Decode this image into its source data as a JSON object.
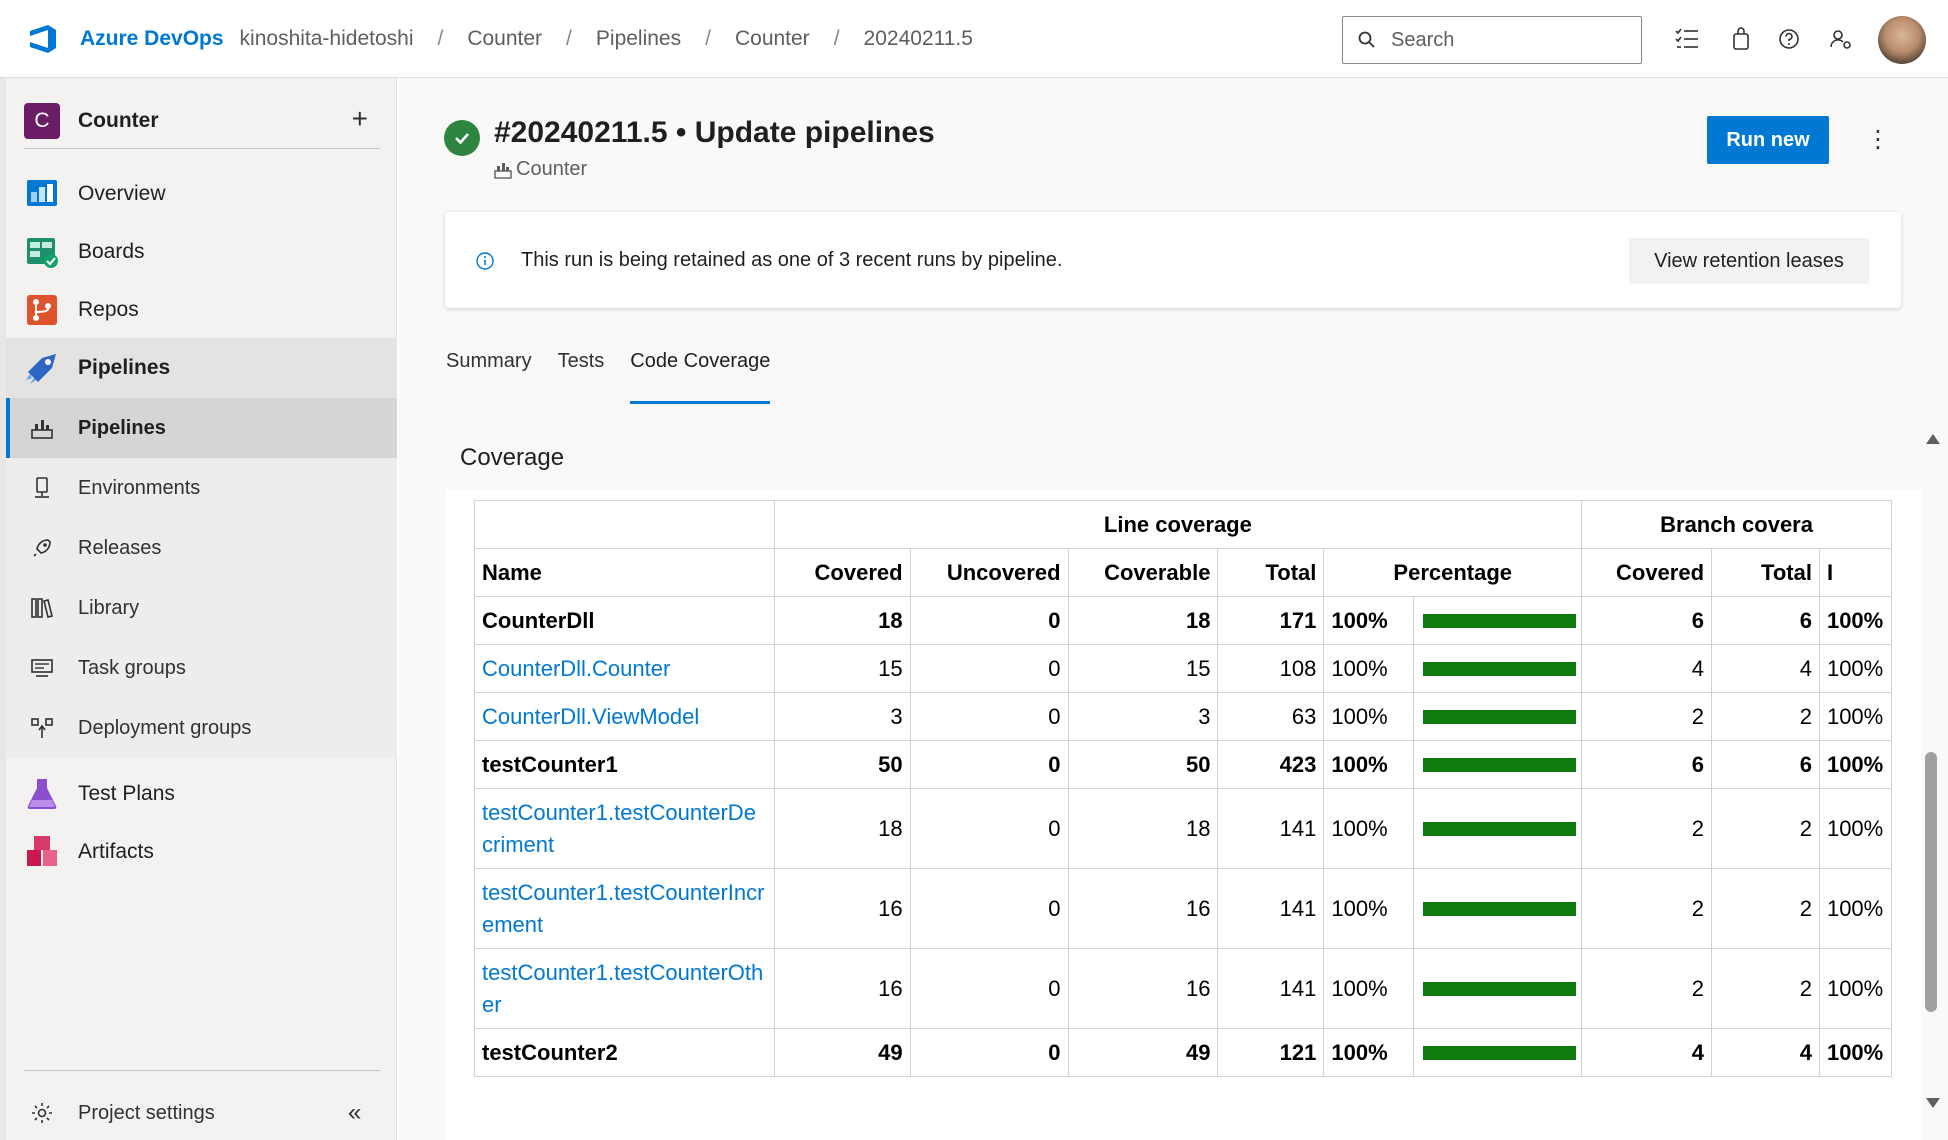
{
  "header": {
    "brand": "Azure DevOps",
    "breadcrumbs": [
      "kinoshita-hidetoshi",
      "Counter",
      "Pipelines",
      "Counter",
      "20240211.5"
    ],
    "search_placeholder": "Search"
  },
  "sidebar": {
    "project_initial": "C",
    "project_name": "Counter",
    "items": [
      {
        "label": "Overview"
      },
      {
        "label": "Boards"
      },
      {
        "label": "Repos"
      },
      {
        "label": "Pipelines"
      }
    ],
    "pipelines_sub": [
      {
        "label": "Pipelines"
      },
      {
        "label": "Environments"
      },
      {
        "label": "Releases"
      },
      {
        "label": "Library"
      },
      {
        "label": "Task groups"
      },
      {
        "label": "Deployment groups"
      }
    ],
    "items_after": [
      {
        "label": "Test Plans"
      },
      {
        "label": "Artifacts"
      }
    ],
    "settings_label": "Project settings"
  },
  "run": {
    "title": "#20240211.5 • Update pipelines",
    "pipeline_name": "Counter",
    "run_new_label": "Run new"
  },
  "banner": {
    "message": "This run is being retained as one of 3 recent runs by pipeline.",
    "button_label": "View retention leases"
  },
  "tabs": [
    "Summary",
    "Tests",
    "Code Coverage"
  ],
  "active_tab": "Code Coverage",
  "coverage": {
    "title": "Coverage",
    "group_headers": {
      "line": "Line coverage",
      "branch": "Branch covera"
    },
    "columns": [
      "Name",
      "Covered",
      "Uncovered",
      "Coverable",
      "Total",
      "Percentage",
      "Covered",
      "Total",
      "I"
    ],
    "rows": [
      {
        "name": "CounterDll",
        "bold": true,
        "link": false,
        "covered": "18",
        "uncovered": "0",
        "coverable": "18",
        "total": "171",
        "pct": "100%",
        "pct_value": 1.0,
        "b_covered": "6",
        "b_total": "6",
        "b_pct": "100%"
      },
      {
        "name": "CounterDll.Counter",
        "bold": false,
        "link": true,
        "covered": "15",
        "uncovered": "0",
        "coverable": "15",
        "total": "108",
        "pct": "100%",
        "pct_value": 1.0,
        "b_covered": "4",
        "b_total": "4",
        "b_pct": "100%"
      },
      {
        "name": "CounterDll.ViewModel",
        "bold": false,
        "link": true,
        "covered": "3",
        "uncovered": "0",
        "coverable": "3",
        "total": "63",
        "pct": "100%",
        "pct_value": 1.0,
        "b_covered": "2",
        "b_total": "2",
        "b_pct": "100%"
      },
      {
        "name": "testCounter1",
        "bold": true,
        "link": false,
        "covered": "50",
        "uncovered": "0",
        "coverable": "50",
        "total": "423",
        "pct": "100%",
        "pct_value": 1.0,
        "b_covered": "6",
        "b_total": "6",
        "b_pct": "100%"
      },
      {
        "name": "testCounter1.testCounterDecriment",
        "bold": false,
        "link": true,
        "covered": "18",
        "uncovered": "0",
        "coverable": "18",
        "total": "141",
        "pct": "100%",
        "pct_value": 1.0,
        "b_covered": "2",
        "b_total": "2",
        "b_pct": "100%"
      },
      {
        "name": "testCounter1.testCounterIncrement",
        "bold": false,
        "link": true,
        "covered": "16",
        "uncovered": "0",
        "coverable": "16",
        "total": "141",
        "pct": "100%",
        "pct_value": 1.0,
        "b_covered": "2",
        "b_total": "2",
        "b_pct": "100%"
      },
      {
        "name": "testCounter1.testCounterOther",
        "bold": false,
        "link": true,
        "covered": "16",
        "uncovered": "0",
        "coverable": "16",
        "total": "141",
        "pct": "100%",
        "pct_value": 1.0,
        "b_covered": "2",
        "b_total": "2",
        "b_pct": "100%"
      },
      {
        "name": "testCounter2",
        "bold": true,
        "link": false,
        "covered": "49",
        "uncovered": "0",
        "coverable": "49",
        "total": "121",
        "pct": "100%",
        "pct_value": 1.0,
        "b_covered": "4",
        "b_total": "4",
        "b_pct": "100%"
      }
    ]
  },
  "colors": {
    "accent": "#0078d4",
    "success": "#2e8540",
    "coverage_bar": "#107c10",
    "project_badge": "#6b1c66"
  }
}
